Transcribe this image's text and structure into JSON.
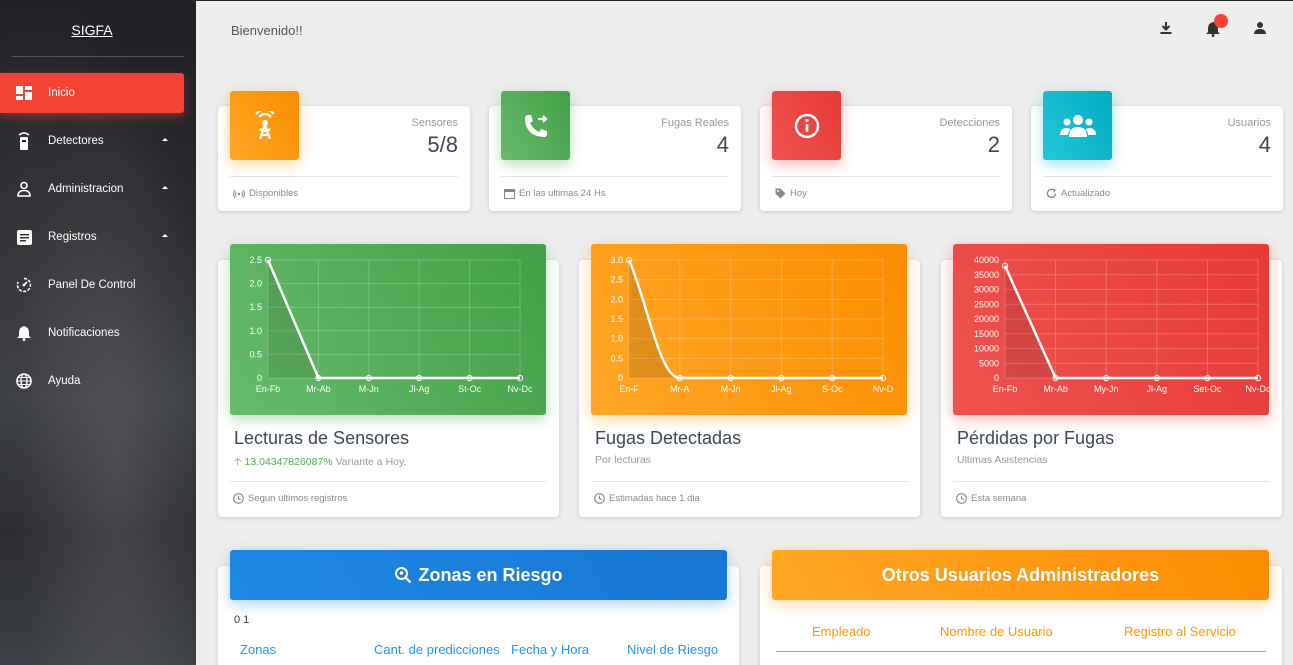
{
  "sidebar": {
    "brand": "SIGFA",
    "items": [
      {
        "label": "Inicio",
        "icon": "dashboard-icon"
      },
      {
        "label": "Detectores",
        "icon": "detector-icon"
      },
      {
        "label": "Administracion",
        "icon": "person-icon"
      },
      {
        "label": "Registros",
        "icon": "list-icon"
      },
      {
        "label": "Panel De Control",
        "icon": "speed-icon"
      },
      {
        "label": "Notificaciones",
        "icon": "bell-icon"
      },
      {
        "label": "Ayuda",
        "icon": "globe-icon"
      }
    ]
  },
  "header": {
    "welcome": "Bienvenido!!",
    "icons": [
      "download-icon",
      "notifications-icon",
      "user-icon"
    ]
  },
  "stats": [
    {
      "label": "Sensores",
      "value": "5/8",
      "footer": "Disponibles",
      "color": "#ff9800",
      "icon": "antenna-icon"
    },
    {
      "label": "Fugas Reales",
      "value": "4",
      "footer": "En las ultimas 24 Hs",
      "color": "#4caf50",
      "icon": "phone-forward-icon"
    },
    {
      "label": "Detecciones",
      "value": "2",
      "footer": "Hoy",
      "color": "#e53935",
      "icon": "info-icon"
    },
    {
      "label": "Usuarios",
      "value": "4",
      "footer": "Actualizado",
      "color": "#00acc1",
      "icon": "group-icon"
    }
  ],
  "charts": [
    {
      "title": "Lecturas de Sensores",
      "variant": "13.04347826087%",
      "subtitle_suffix": "Variante a Hoy.",
      "footer": "Segun ultimos registros",
      "color": "#4caf50"
    },
    {
      "title": "Fugas Detectadas",
      "subtitle": "Por lecturas",
      "footer": "Estimadas hace 1 dia",
      "color": "#ff9800"
    },
    {
      "title": "Pérdidas por Fugas",
      "subtitle": "Ultimas Asistencias",
      "footer": "Esta semana",
      "color": "#e53935"
    }
  ],
  "chart_data": [
    {
      "type": "line",
      "categories": [
        "En-Fb",
        "Mr-Ab",
        "M-Jn",
        "Jl-Ag",
        "St-Oc",
        "Nv-Dc"
      ],
      "values": [
        2.5,
        0,
        0,
        0,
        0,
        0
      ],
      "ylim": [
        0,
        2.5
      ],
      "yticks": [
        "0",
        "0.5",
        "1.0",
        "1.5",
        "2.0",
        "2.5"
      ],
      "grid": true
    },
    {
      "type": "area",
      "categories": [
        "En-F",
        "Mr-A",
        "M-Jn",
        "Jl-Ag",
        "S-Oc",
        "Nv-D"
      ],
      "values": [
        3.0,
        0,
        0,
        0,
        0,
        0
      ],
      "ylim": [
        0,
        3.0
      ],
      "yticks": [
        "0",
        "0.5",
        "1.0",
        "1.5",
        "2.0",
        "2.5",
        "3.0"
      ],
      "grid": true
    },
    {
      "type": "line",
      "categories": [
        "En-Fb",
        "Mr-Ab",
        "My-Jn",
        "Jl-Ag",
        "Set-Oc",
        "Nv-Dc"
      ],
      "values": [
        38000,
        0,
        0,
        0,
        0,
        0
      ],
      "ylim": [
        0,
        40000
      ],
      "yticks": [
        "0",
        "5000",
        "10000",
        "15000",
        "20000",
        "25000",
        "30000",
        "35000",
        "40000"
      ],
      "grid": true
    }
  ],
  "zonas": {
    "title": "Zonas en Riesgo",
    "count": "0 1",
    "columns": [
      "Zonas",
      "Cant. de predicciones",
      "Fecha y Hora",
      "Nivel de Riesgo"
    ]
  },
  "admins": {
    "title": "Otros Usuarios Administradores",
    "columns": [
      "Empleado",
      "Nombre de Usuario",
      "Registro al Servicio"
    ]
  }
}
